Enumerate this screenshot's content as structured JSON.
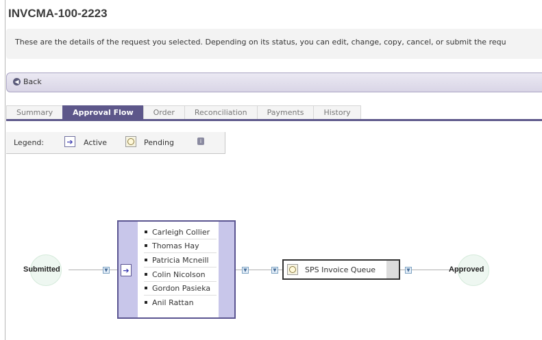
{
  "page": {
    "title": "INVCMA-100-2223",
    "info_text": "These are the details of the request you selected. Depending on its status, you can edit, change, copy, cancel, or submit the requ"
  },
  "nav": {
    "back_label": "Back"
  },
  "tabs": [
    {
      "label": "Summary",
      "active": false
    },
    {
      "label": "Approval Flow",
      "active": true
    },
    {
      "label": "Order",
      "active": false
    },
    {
      "label": "Reconciliation",
      "active": false
    },
    {
      "label": "Payments",
      "active": false
    },
    {
      "label": "History",
      "active": false
    }
  ],
  "legend": {
    "label": "Legend:",
    "active_label": "Active",
    "pending_label": "Pending"
  },
  "flow": {
    "start_label": "Submitted",
    "end_label": "Approved",
    "approvers": [
      "Carleigh Collier",
      "Thomas Hay",
      "Patricia Mcneill",
      "Colin Nicolson",
      "Gordon Pasieka",
      "Anil Rattan"
    ],
    "queue_label": "SPS Invoice Queue"
  },
  "colors": {
    "accent": "#5d578a",
    "stage_bg": "#c8c6ea",
    "node_bg": "#eef7f1"
  },
  "icons": {
    "back": "circle-arrow-left-icon",
    "active": "arrow-right-icon",
    "pending": "clock-icon",
    "info": "info-icon",
    "toggle": "chevron-down-icon"
  }
}
